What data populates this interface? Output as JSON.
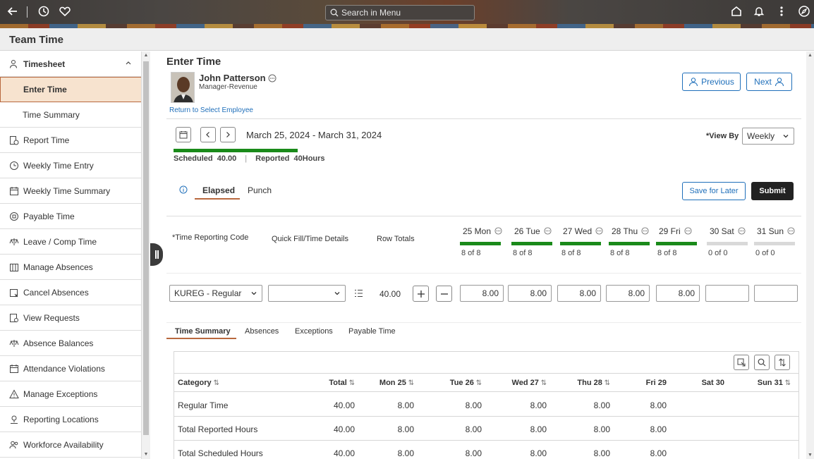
{
  "banner": {
    "search_placeholder": "Search in Menu",
    "icons": [
      "back-arrow-icon",
      "history-icon",
      "favorite-icon",
      "home-icon",
      "notification-icon",
      "more-icon",
      "navigator-icon"
    ]
  },
  "page": {
    "title": "Team Time"
  },
  "sidebar": {
    "items": [
      {
        "label": "Timesheet",
        "icon": "person-icon",
        "type": "header"
      },
      {
        "label": "Enter Time",
        "type": "sub-active"
      },
      {
        "label": "Time Summary",
        "type": "sub"
      },
      {
        "label": "Report Time",
        "icon": "report-time-icon"
      },
      {
        "label": "Weekly Time Entry",
        "icon": "weekly-entry-icon"
      },
      {
        "label": "Weekly Time Summary",
        "icon": "calendar-icon"
      },
      {
        "label": "Payable Time",
        "icon": "payable-icon"
      },
      {
        "label": "Leave / Comp Time",
        "icon": "balance-icon"
      },
      {
        "label": "Manage Absences",
        "icon": "absences-icon"
      },
      {
        "label": "Cancel Absences",
        "icon": "cancel-absences-icon"
      },
      {
        "label": "View Requests",
        "icon": "requests-icon"
      },
      {
        "label": "Absence Balances",
        "icon": "balance-icon"
      },
      {
        "label": "Attendance Violations",
        "icon": "calendar-icon"
      },
      {
        "label": "Manage Exceptions",
        "icon": "warning-icon"
      },
      {
        "label": "Reporting Locations",
        "icon": "location-icon"
      },
      {
        "label": "Workforce Availability",
        "icon": "people-icon"
      }
    ]
  },
  "main": {
    "heading": "Enter Time",
    "employee": {
      "name": "John Patterson",
      "title": "Manager-Revenue",
      "return_link": "Return to Select Employee"
    },
    "nav_buttons": {
      "previous": "Previous",
      "next": "Next"
    },
    "period": {
      "range": "March 25, 2024 - March 31, 2024",
      "view_by_label": "*View By",
      "view_by_value": "Weekly"
    },
    "summary": {
      "scheduled": "Scheduled  40.00",
      "reported": "Reported  40Hours"
    },
    "entry_tabs": {
      "elapsed": "Elapsed",
      "punch": "Punch"
    },
    "actions": {
      "save_later": "Save for Later",
      "submit": "Submit"
    },
    "columns": {
      "trc": "*Time Reporting Code",
      "quick_fill": "Quick Fill/Time Details",
      "row_totals": "Row Totals"
    },
    "days": [
      {
        "label": "25 Mon",
        "of": "8 of 8",
        "status": "complete"
      },
      {
        "label": "26 Tue",
        "of": "8 of 8",
        "status": "complete"
      },
      {
        "label": "27 Wed",
        "of": "8 of 8",
        "status": "complete"
      },
      {
        "label": "28 Thu",
        "of": "8 of 8",
        "status": "complete"
      },
      {
        "label": "29 Fri",
        "of": "8 of 8",
        "status": "complete"
      },
      {
        "label": "30 Sat",
        "of": "0 of 0",
        "status": "empty"
      },
      {
        "label": "31 Sun",
        "of": "0 of 0",
        "status": "empty"
      }
    ],
    "entry_row": {
      "trc": "KUREG - Regular",
      "quick_fill": "",
      "row_total": "40.00",
      "hours": [
        "8.00",
        "8.00",
        "8.00",
        "8.00",
        "8.00",
        "",
        ""
      ]
    },
    "bottom_tabs": [
      "Time Summary",
      "Absences",
      "Exceptions",
      "Payable Time"
    ],
    "grid": {
      "headers": [
        "Category",
        "Total",
        "Mon 25",
        "Tue 26",
        "Wed 27",
        "Thu 28",
        "Fri 29",
        "Sat 30",
        "Sun 31"
      ],
      "rows": [
        {
          "category": "Regular Time",
          "values": [
            "40.00",
            "8.00",
            "8.00",
            "8.00",
            "8.00",
            "8.00",
            "",
            ""
          ]
        },
        {
          "category": "Total Reported Hours",
          "values": [
            "40.00",
            "8.00",
            "8.00",
            "8.00",
            "8.00",
            "8.00",
            "",
            ""
          ]
        },
        {
          "category": "Total Scheduled Hours",
          "values": [
            "40.00",
            "8.00",
            "8.00",
            "8.00",
            "8.00",
            "8.00",
            "",
            ""
          ]
        }
      ]
    }
  },
  "colors": {
    "accent": "#b8683e",
    "link": "#1f6fba",
    "complete_bar": "#1a8a1a",
    "empty_bar": "#d9d9d9",
    "banner": "#3d3a38"
  }
}
